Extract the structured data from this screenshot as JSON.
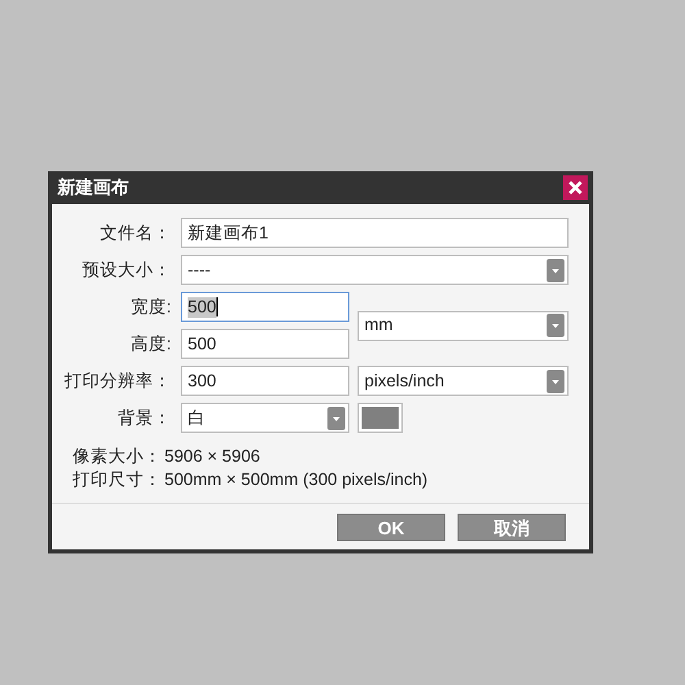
{
  "dialog": {
    "title": "新建画布",
    "file_name": {
      "label": "文件名：",
      "value": "新建画布1"
    },
    "preset": {
      "label": "预设大小：",
      "value": "----"
    },
    "width": {
      "label": "宽度:",
      "value": "500",
      "focused": true
    },
    "height": {
      "label": "高度:",
      "value": "500",
      "focused": false
    },
    "size_unit": {
      "value": "mm"
    },
    "resolution": {
      "label": "打印分辨率：",
      "value": "300"
    },
    "resolution_unit": {
      "value": "pixels/inch"
    },
    "background": {
      "label": "背景：",
      "value": "白",
      "color": "#808080"
    },
    "info": [
      {
        "label": "像素大小：",
        "value": "5906 × 5906"
      },
      {
        "label": "打印尺寸：",
        "value": "500mm × 500mm (300 pixels/inch)"
      }
    ],
    "buttons": [
      {
        "label": "OK"
      },
      {
        "label": "取消"
      }
    ]
  }
}
